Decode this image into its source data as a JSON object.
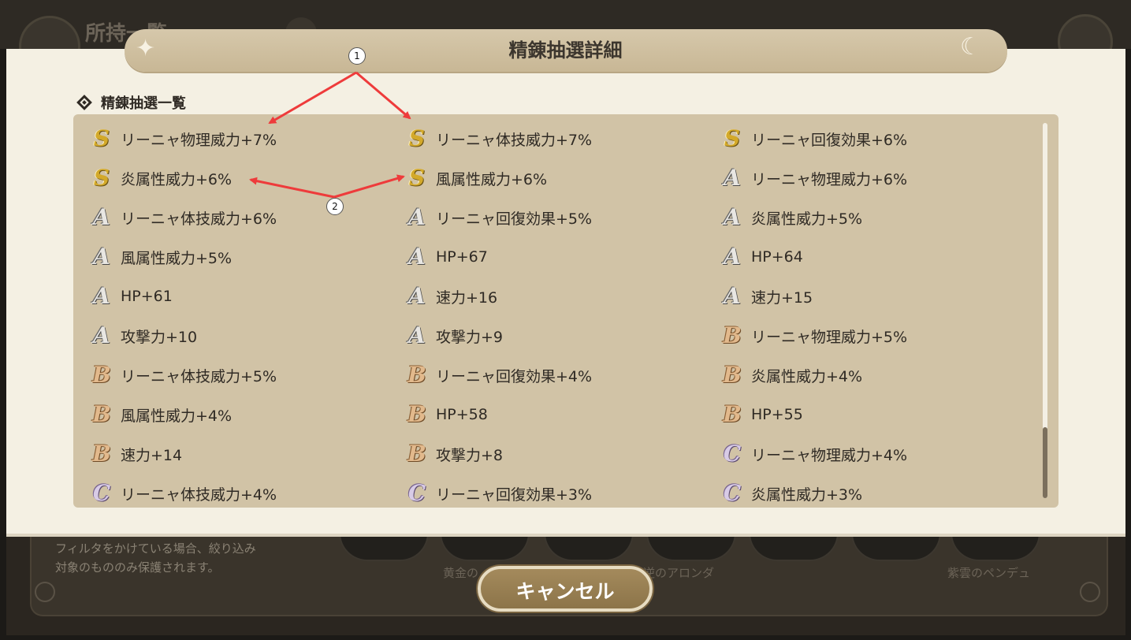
{
  "background": {
    "page_title": "所持一覧",
    "filter_note_line1": "フィルタをかけている場合、絞り込み",
    "filter_note_line2": "対象のもののみ保護されます。",
    "item_caption_1": "黄金の",
    "item_caption_2": "逆のアロンダ",
    "item_caption_3": "紫雲のペンデュ"
  },
  "modal": {
    "title": "精錬抽選詳細",
    "section_title": "精錬抽選一覧",
    "cancel_label": "キャンセル"
  },
  "entries": [
    {
      "rank": "S",
      "label": "リーニャ物理威力+7%"
    },
    {
      "rank": "S",
      "label": "リーニャ体技威力+7%"
    },
    {
      "rank": "S",
      "label": "リーニャ回復効果+6%"
    },
    {
      "rank": "S",
      "label": "炎属性威力+6%"
    },
    {
      "rank": "S",
      "label": "風属性威力+6%"
    },
    {
      "rank": "A",
      "label": "リーニャ物理威力+6%"
    },
    {
      "rank": "A",
      "label": "リーニャ体技威力+6%"
    },
    {
      "rank": "A",
      "label": "リーニャ回復効果+5%"
    },
    {
      "rank": "A",
      "label": "炎属性威力+5%"
    },
    {
      "rank": "A",
      "label": "風属性威力+5%"
    },
    {
      "rank": "A",
      "label": "HP+67"
    },
    {
      "rank": "A",
      "label": "HP+64"
    },
    {
      "rank": "A",
      "label": "HP+61"
    },
    {
      "rank": "A",
      "label": "速力+16"
    },
    {
      "rank": "A",
      "label": "速力+15"
    },
    {
      "rank": "A",
      "label": "攻撃力+10"
    },
    {
      "rank": "A",
      "label": "攻撃力+9"
    },
    {
      "rank": "B",
      "label": "リーニャ物理威力+5%"
    },
    {
      "rank": "B",
      "label": "リーニャ体技威力+5%"
    },
    {
      "rank": "B",
      "label": "リーニャ回復効果+4%"
    },
    {
      "rank": "B",
      "label": "炎属性威力+4%"
    },
    {
      "rank": "B",
      "label": "風属性威力+4%"
    },
    {
      "rank": "B",
      "label": "HP+58"
    },
    {
      "rank": "B",
      "label": "HP+55"
    },
    {
      "rank": "B",
      "label": "速力+14"
    },
    {
      "rank": "B",
      "label": "攻撃力+8"
    },
    {
      "rank": "C",
      "label": "リーニャ物理威力+4%"
    },
    {
      "rank": "C",
      "label": "リーニャ体技威力+4%"
    },
    {
      "rank": "C",
      "label": "リーニャ回復効果+3%"
    },
    {
      "rank": "C",
      "label": "炎属性威力+3%"
    }
  ],
  "annotations": [
    {
      "label": "1"
    },
    {
      "label": "2"
    }
  ],
  "colors": {
    "annotation_arrow": "#ee3b3b",
    "rank_S": "#d3a92a",
    "rank_A": "#e8e6e2",
    "rank_B": "#e2b98c",
    "rank_C": "#d8cbe6"
  }
}
